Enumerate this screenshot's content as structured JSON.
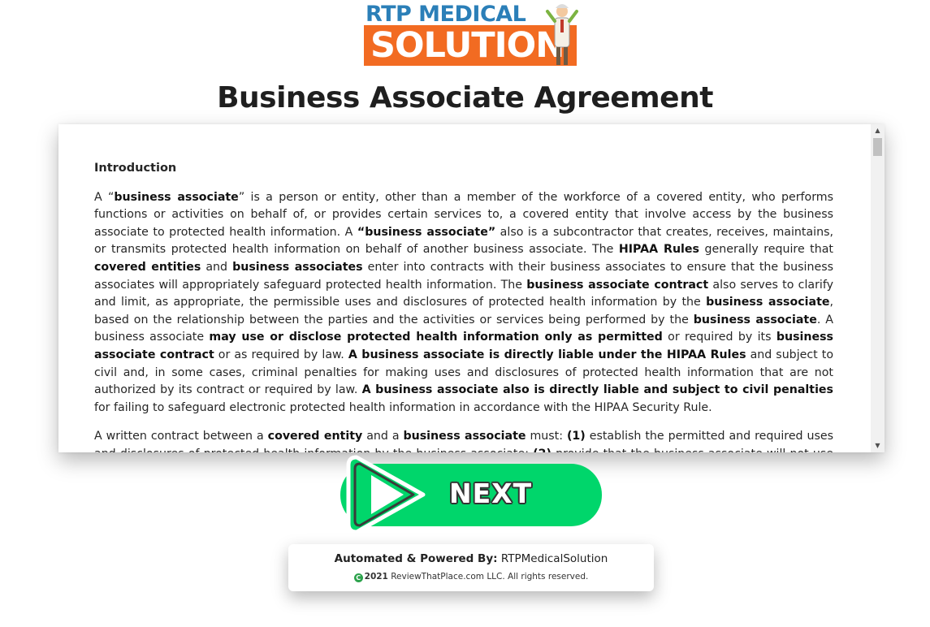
{
  "logo": {
    "top_text": "RTP MEDICAL",
    "bottom_text": "SOLUTION"
  },
  "page_title": "Business Associate Agreement",
  "agreement": {
    "heading": "Introduction",
    "paragraphs": [
      [
        {
          "t": "A “"
        },
        {
          "t": "business associate",
          "b": true
        },
        {
          "t": "” is a person or entity, other than a member of the workforce of a covered entity, who performs functions or activities on behalf of, or provides certain services to, a covered entity that involve access by the business associate to protected health information. A "
        },
        {
          "t": "“business associate”",
          "b": true
        },
        {
          "t": " also is a subcontractor that creates, receives, maintains, or transmits protected health information on behalf of another business associate. The "
        },
        {
          "t": "HIPAA Rules",
          "b": true
        },
        {
          "t": " generally require that "
        },
        {
          "t": "covered entities",
          "b": true
        },
        {
          "t": " and "
        },
        {
          "t": "business associates",
          "b": true
        },
        {
          "t": " enter into contracts with their business associates to ensure that the business associates will appropriately safeguard protected health information. The "
        },
        {
          "t": "business associate contract",
          "b": true
        },
        {
          "t": " also serves to clarify and limit, as appropriate, the permissible uses and disclosures of protected health information by the "
        },
        {
          "t": "business associate",
          "b": true
        },
        {
          "t": ", based on the relationship between the parties and the activities or services being performed by the "
        },
        {
          "t": "business associate",
          "b": true
        },
        {
          "t": ". A business associate "
        },
        {
          "t": "may use or disclose protected health information only as permitted",
          "b": true
        },
        {
          "t": " or required by its "
        },
        {
          "t": "business associate contract",
          "b": true
        },
        {
          "t": " or as required by law. "
        },
        {
          "t": "A business associate is directly liable under the HIPAA Rules",
          "b": true
        },
        {
          "t": " and subject to civil and, in some cases, criminal penalties for making uses and disclosures of protected health information that are not authorized by its contract or required by law. "
        },
        {
          "t": "A business associate also is directly liable and subject to civil penalties",
          "b": true
        },
        {
          "t": " for failing to safeguard electronic protected health information in accordance with the HIPAA Security Rule."
        }
      ],
      [
        {
          "t": "A written contract between a "
        },
        {
          "t": "covered entity",
          "b": true
        },
        {
          "t": " and a "
        },
        {
          "t": "business associate",
          "b": true
        },
        {
          "t": " must: "
        },
        {
          "t": "(1)",
          "b": true
        },
        {
          "t": " establish the permitted and required uses and disclosures of protected health information by the business associate; "
        },
        {
          "t": "(2)",
          "b": true
        },
        {
          "t": " provide that the business associate will not use or further disclose the information other than as permitted or required by the contract or as required by law;"
        }
      ]
    ]
  },
  "next_button": {
    "label": "NEXT"
  },
  "footer": {
    "powered_label": "Automated & Powered By:",
    "powered_value": "RTPMedicalSolution",
    "copyright_symbol": "C",
    "year": "2021",
    "rights": "ReviewThatPlace.com LLC. All rights reserved."
  },
  "colors": {
    "logo_blue": "#2b7fb8",
    "logo_orange": "#f26b22",
    "next_green": "#00d66b"
  }
}
